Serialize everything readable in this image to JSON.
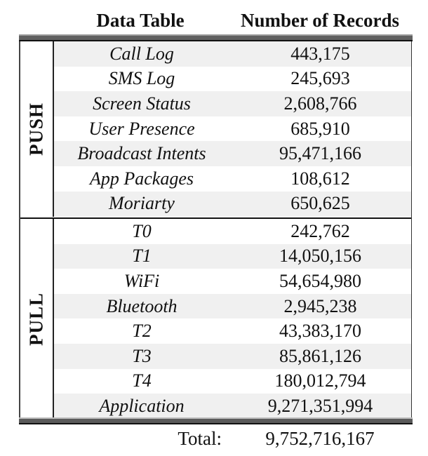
{
  "header": {
    "col_table": "Data Table",
    "col_records": "Number of Records"
  },
  "groups": {
    "push": {
      "label": "PUSH",
      "rows": [
        {
          "name": "Call Log",
          "value": "443,175"
        },
        {
          "name": "SMS Log",
          "value": "245,693"
        },
        {
          "name": "Screen Status",
          "value": "2,608,766"
        },
        {
          "name": "User Presence",
          "value": "685,910"
        },
        {
          "name": "Broadcast Intents",
          "value": "95,471,166"
        },
        {
          "name": "App Packages",
          "value": "108,612"
        },
        {
          "name": "Moriarty",
          "value": "650,625"
        }
      ]
    },
    "pull": {
      "label": "PULL",
      "rows": [
        {
          "name": "T0",
          "value": "242,762"
        },
        {
          "name": "T1",
          "value": "14,050,156"
        },
        {
          "name": "WiFi",
          "value": "54,654,980"
        },
        {
          "name": "Bluetooth",
          "value": "2,945,238"
        },
        {
          "name": "T2",
          "value": "43,383,170"
        },
        {
          "name": "T3",
          "value": "85,861,126"
        },
        {
          "name": "T4",
          "value": "180,012,794"
        },
        {
          "name": "Application",
          "value": "9,271,351,994"
        }
      ]
    }
  },
  "total": {
    "label": "Total:",
    "value": "9,752,716,167"
  },
  "colors": {
    "stripe": "#f0f0f0",
    "rule": "#606060"
  }
}
